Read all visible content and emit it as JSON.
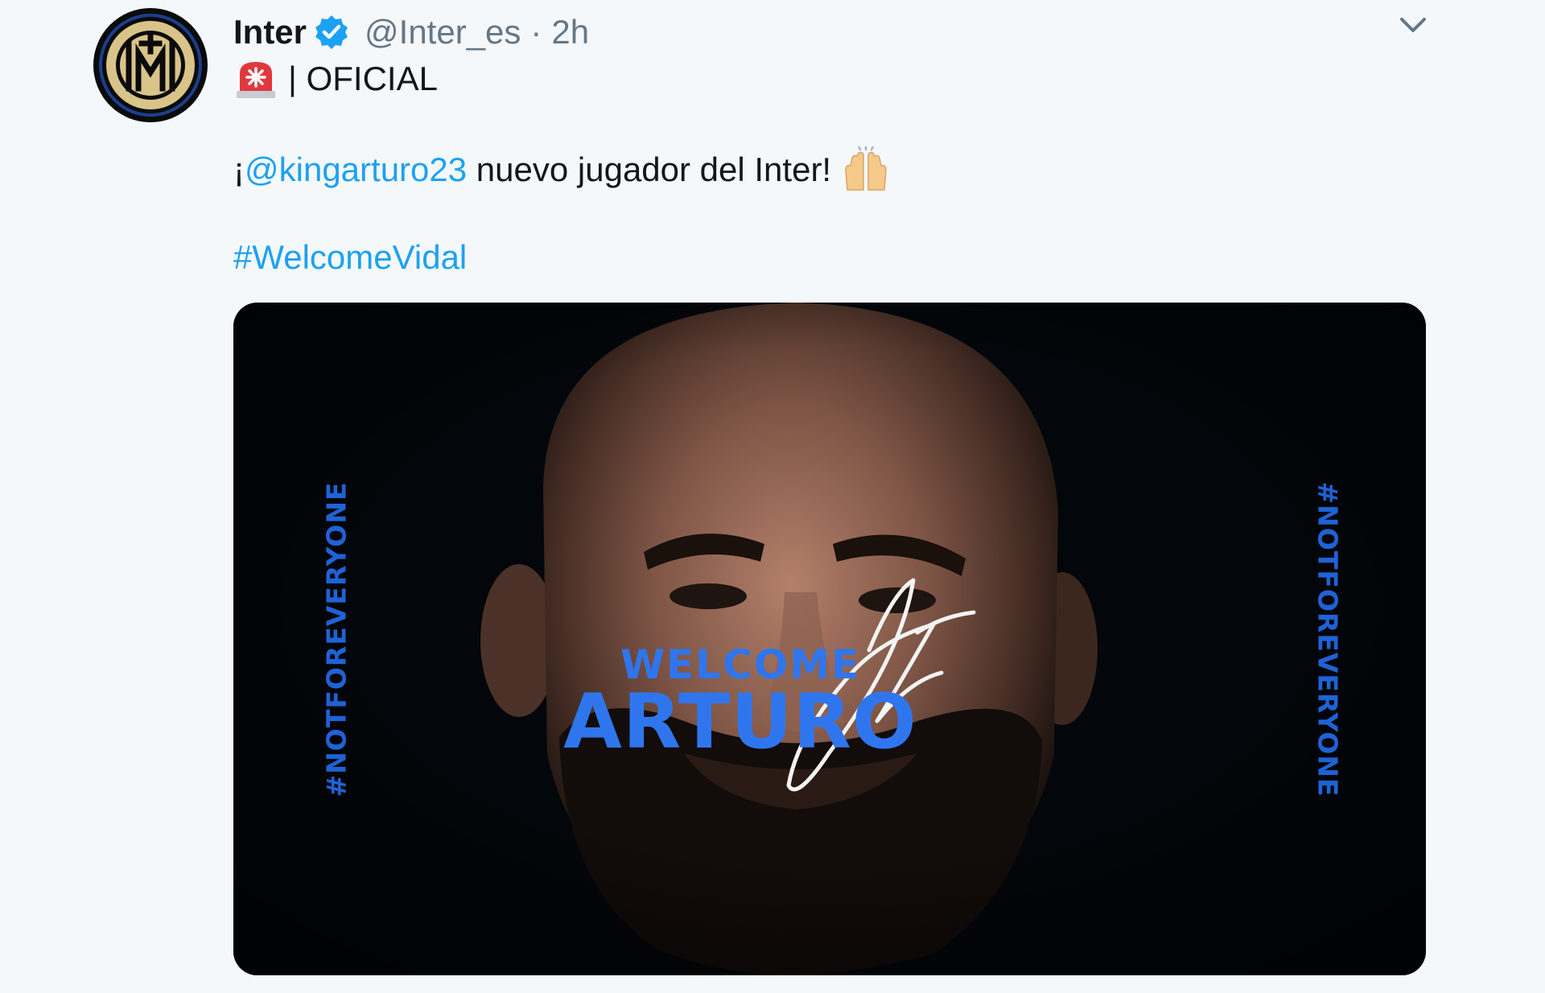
{
  "tweet": {
    "author_name": "Inter",
    "author_handle": "@Inter_es",
    "separator": "·",
    "time": "2h",
    "line1_text": "| OFICIAL",
    "line2_prefix": "¡",
    "mention": "@kingarturo23",
    "line2_rest": " nuevo jugador del Inter!",
    "hashtag": "#WelcomeVidal"
  },
  "media": {
    "tag_left": "#NOTFOREVERYONE",
    "tag_right": "#NOTFOREVERYONE",
    "welcome_line1": "WELCOME",
    "welcome_line2": "ARTURO",
    "signature_text": "Vidal"
  },
  "icons": {
    "avatar": "inter-logo",
    "verified": "verified-badge-icon",
    "caret": "chevron-down-icon",
    "emoji1": "rotating-light-emoji",
    "emoji2": "raising-hands-emoji"
  },
  "colors": {
    "background": "#f5f8fa",
    "link": "#1da1f2",
    "secondary_text": "#657786",
    "accent_blue": "#1e63d6"
  }
}
